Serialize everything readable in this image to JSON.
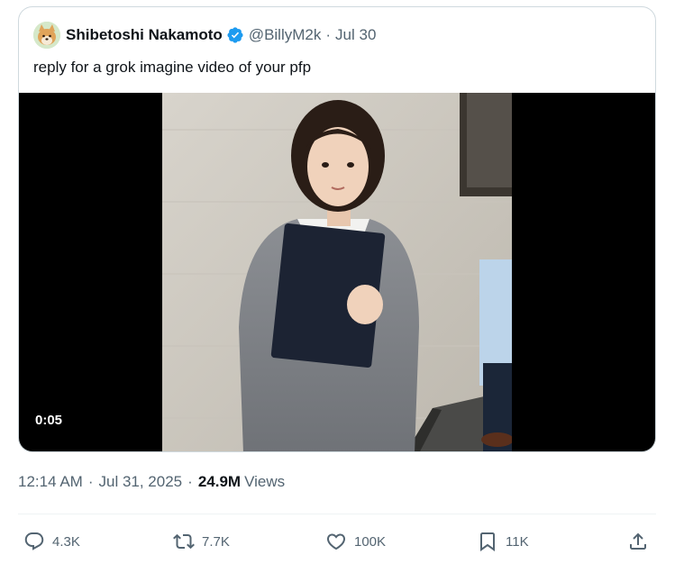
{
  "quote": {
    "author_name": "Shibetoshi Nakamoto",
    "handle": "@BillyM2k",
    "separator": "·",
    "date": "Jul 30",
    "text": "reply for a grok imagine video of your pfp",
    "video_timestamp": "0:05"
  },
  "post": {
    "time": "12:14 AM",
    "date": "Jul 31, 2025",
    "separator": "·",
    "views_count": "24.9M",
    "views_label": "Views"
  },
  "actions": {
    "reply_count": "4.3K",
    "repost_count": "7.7K",
    "like_count": "100K",
    "bookmark_count": "11K"
  },
  "colors": {
    "text_primary": "#0f1419",
    "text_secondary": "#536471",
    "verified_blue": "#1d9bf0",
    "border": "#cfd9de"
  }
}
